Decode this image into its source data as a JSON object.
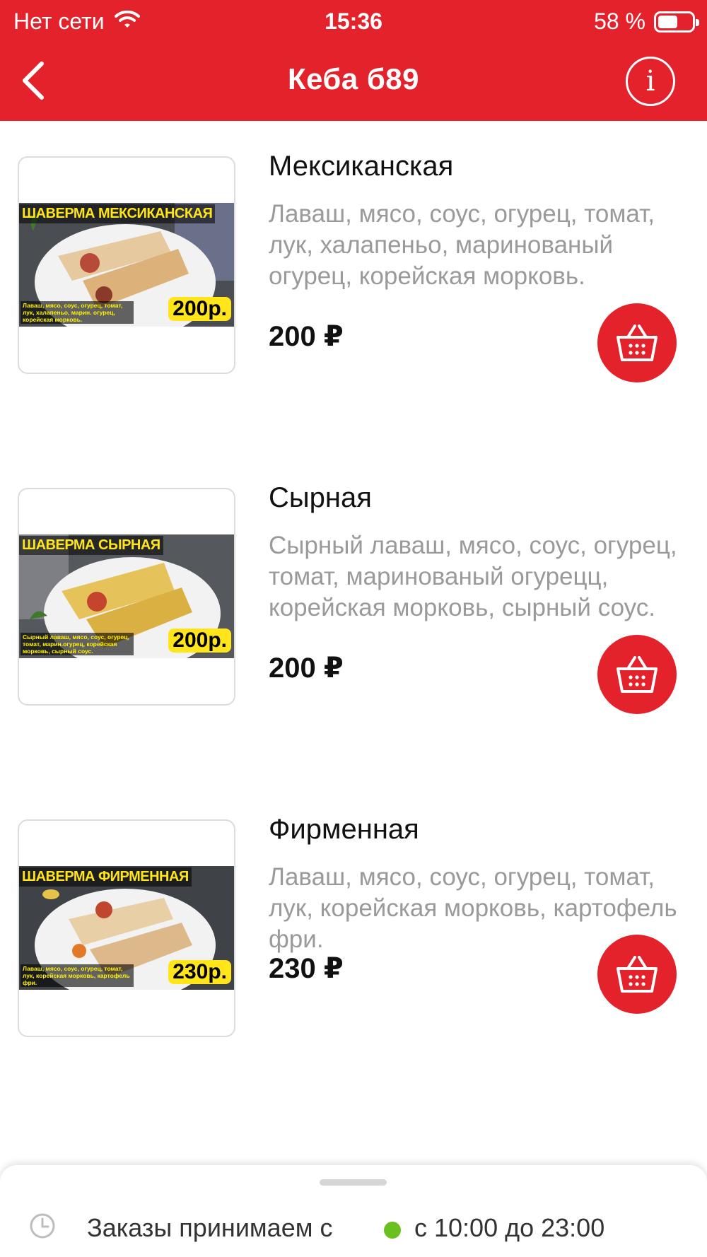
{
  "status_bar": {
    "carrier": "Нет сети",
    "time": "15:36",
    "battery": "58 %",
    "battery_level": 0.58
  },
  "nav": {
    "title": "Кеба б89"
  },
  "items": [
    {
      "name": "Мексиканская",
      "description": "Лаваш, мясо, соус, огурец, томат, лук, халапеньо, маринованый огурец, корейская морковь.",
      "price": "200 ₽",
      "photo_banner": "ШАВЕРМА МЕКСИКАНСКАЯ",
      "photo_caption": "Лаваш, мясо, соус, огурец, томат, лук, халапеньо, марин. огурец, корейская морковь.",
      "photo_price": "200р."
    },
    {
      "name": "Сырная",
      "description": "Сырный лаваш, мясо, соус, огурец, томат, маринованый огурецц, корейская морковь, сырный соус.",
      "price": "200 ₽",
      "photo_banner": "ШАВЕРМА СЫРНАЯ",
      "photo_caption": "Сырный лаваш, мясо, соус, огурец, томат, марин.огурец, корейская морковь, сырный соус.",
      "photo_price": "200р."
    },
    {
      "name": "Фирменная",
      "description": "Лаваш, мясо, соус, огурец, томат, лук, корейская морковь, картофель фри.",
      "price": "230 ₽",
      "photo_banner": "ШАВЕРМА ФИРМЕННАЯ",
      "photo_caption": "Лаваш, мясо, соус, огурец, томат, лук, корейская морковь, картофель фри.",
      "photo_price": "230р."
    }
  ],
  "footer": {
    "label": "Заказы принимаем с",
    "hours": "с 10:00 до 23:00"
  },
  "colors": {
    "brand_red": "#e3222b",
    "open_indicator": "#69c01f",
    "description_gray": "#9a9a9a"
  },
  "icons": {
    "status": [
      "wifi-icon",
      "battery-icon"
    ],
    "nav": [
      "chevron-left-icon",
      "info-icon"
    ],
    "item_action": "basket-icon",
    "footer": "clock-icon"
  }
}
